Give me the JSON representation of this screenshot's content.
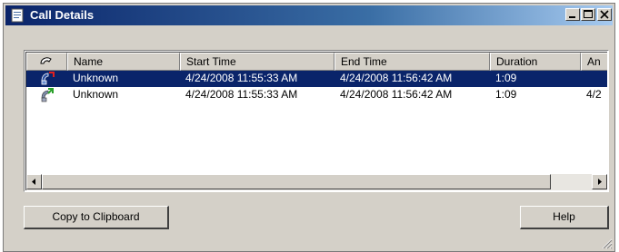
{
  "window": {
    "title": "Call Details"
  },
  "titlebar_buttons": [
    "minimize-icon",
    "maximize-icon",
    "close-icon"
  ],
  "list": {
    "columns": [
      "",
      "Name",
      "Start Time",
      "End Time",
      "Duration",
      "An"
    ],
    "rows": [
      {
        "icon": "incoming-call-icon",
        "name": "Unknown",
        "start": "4/24/2008 11:55:33 AM",
        "end": "4/24/2008 11:56:42 AM",
        "duration": "1:09",
        "extra": "",
        "selected": true
      },
      {
        "icon": "outgoing-call-icon",
        "name": "Unknown",
        "start": "4/24/2008 11:55:33 AM",
        "end": "4/24/2008 11:56:42 AM",
        "duration": "1:09",
        "extra": "4/2",
        "selected": false
      }
    ]
  },
  "buttons": {
    "copy": "Copy to Clipboard",
    "help": "Help"
  },
  "colors": {
    "selection": "#0a246a",
    "face": "#d4d0c8",
    "titlebar_start": "#0a246a"
  }
}
